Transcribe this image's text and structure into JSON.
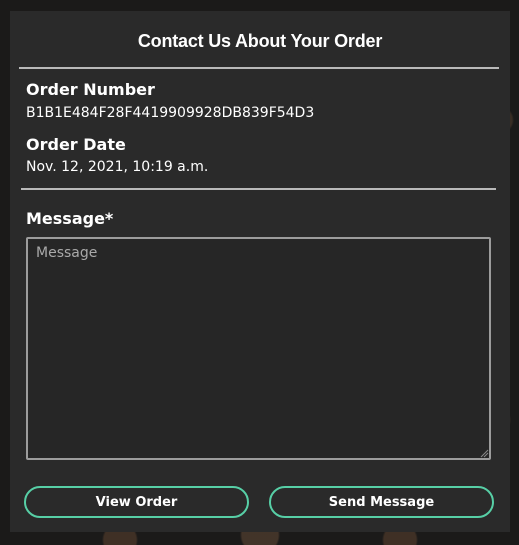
{
  "panel": {
    "title": "Contact Us About Your Order"
  },
  "order": {
    "number_label": "Order Number",
    "number_value": "B1B1E484F28F4419909928DB839F54D3",
    "date_label": "Order Date",
    "date_value": "Nov. 12, 2021, 10:19 a.m."
  },
  "message": {
    "label": "Message*",
    "placeholder": "Message",
    "value": ""
  },
  "buttons": {
    "view_order": "View Order",
    "send_message": "Send Message"
  },
  "colors": {
    "panel_bg": "#2a2a2a",
    "button_border": "#57cfa6",
    "divider": "#b9b9b9"
  }
}
